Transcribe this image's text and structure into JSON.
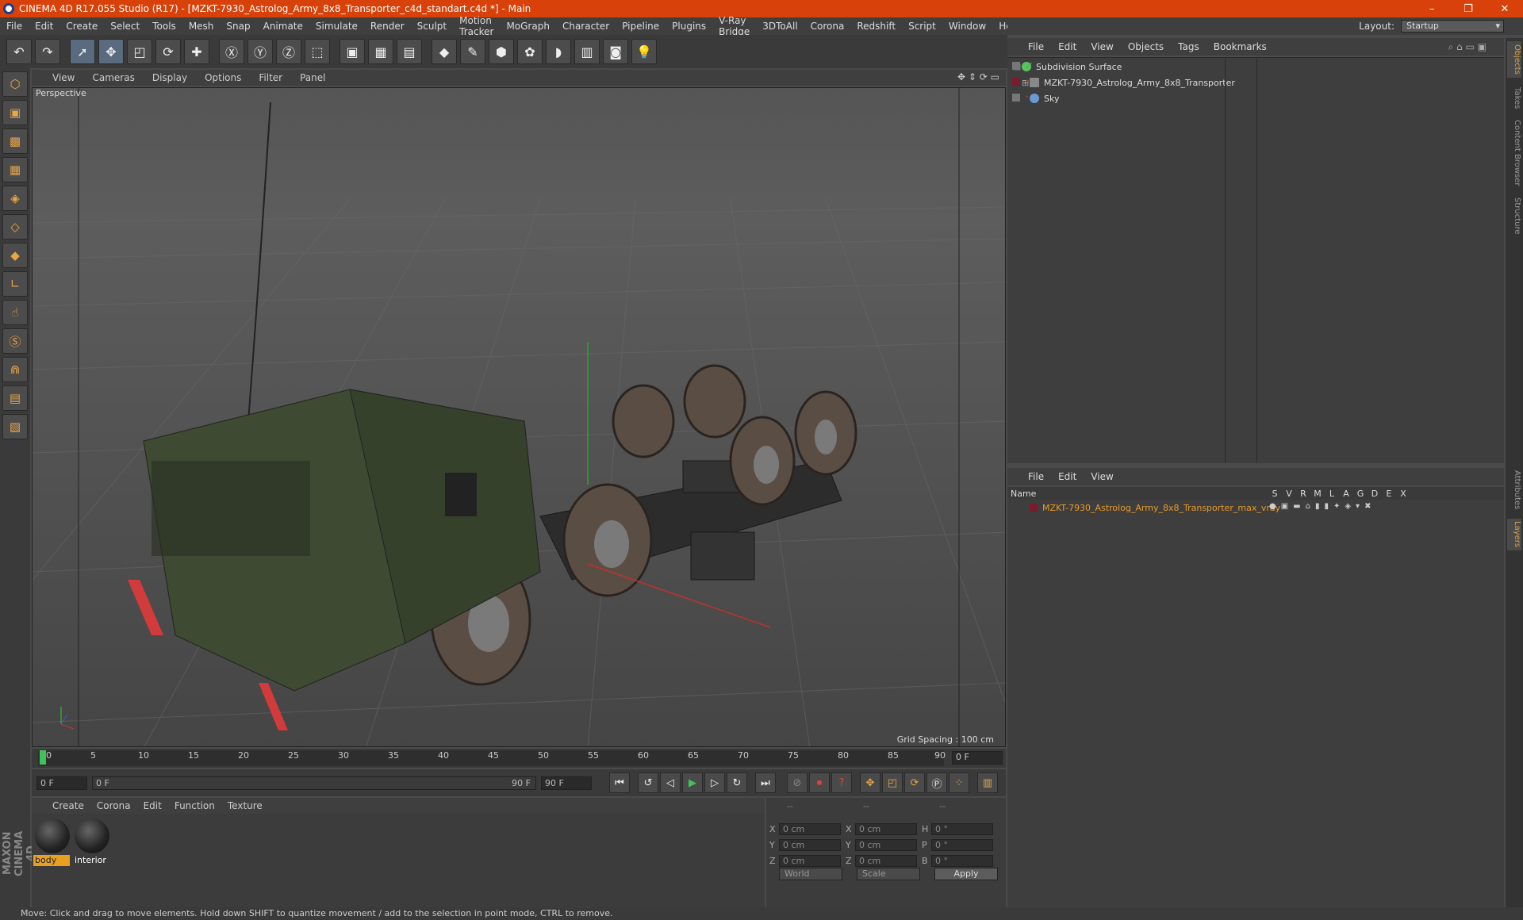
{
  "window": {
    "title": "CINEMA 4D R17.055 Studio (R17) - [MZKT-7930_Astrolog_Army_8x8_Transporter_c4d_standart.c4d *] - Main",
    "minimize": "–",
    "restore": "❐",
    "close": "✕"
  },
  "menubar": [
    "File",
    "Edit",
    "Create",
    "Select",
    "Tools",
    "Mesh",
    "Snap",
    "Animate",
    "Simulate",
    "Render",
    "Sculpt",
    "Motion Tracker",
    "MoGraph",
    "Character",
    "Pipeline",
    "Plugins",
    "V-Ray Bridge",
    "3DToAll",
    "Corona",
    "Redshift",
    "Script",
    "Window",
    "Help"
  ],
  "layout": {
    "label": "Layout:",
    "value": "Startup"
  },
  "viewport": {
    "menu": [
      "View",
      "Cameras",
      "Display",
      "Options",
      "Filter",
      "Panel"
    ],
    "camera_label": "Perspective",
    "grid_spacing": "Grid Spacing : 100 cm"
  },
  "timeline": {
    "ticks": [
      "0",
      "5",
      "10",
      "15",
      "20",
      "25",
      "30",
      "35",
      "40",
      "45",
      "50",
      "55",
      "60",
      "65",
      "70",
      "75",
      "80",
      "85",
      "90"
    ],
    "current_frame": "0 F",
    "start": "0 F",
    "range_start": "0 F",
    "range_end": "90 F",
    "end": "90 F"
  },
  "materials": {
    "menu": [
      "Create",
      "Corona",
      "Edit",
      "Function",
      "Texture"
    ],
    "items": [
      {
        "label": "body"
      },
      {
        "label": "interior"
      }
    ]
  },
  "coords": {
    "headers": [
      "--",
      "--",
      "--"
    ],
    "rows": [
      {
        "l1": "X",
        "v1": "0 cm",
        "l2": "X",
        "v2": "0 cm",
        "l3": "H",
        "v3": "0 °"
      },
      {
        "l1": "Y",
        "v1": "0 cm",
        "l2": "Y",
        "v2": "0 cm",
        "l3": "P",
        "v3": "0 °"
      },
      {
        "l1": "Z",
        "v1": "0 cm",
        "l2": "Z",
        "v2": "0 cm",
        "l3": "B",
        "v3": "0 °"
      }
    ],
    "mode": "World",
    "transform": "Scale",
    "apply": "Apply"
  },
  "objects": {
    "menu": [
      "File",
      "Edit",
      "View",
      "Objects",
      "Tags",
      "Bookmarks"
    ],
    "items": [
      {
        "name": "Subdivision Surface",
        "color": "#5cc25c"
      },
      {
        "name": "MZKT-7930_Astrolog_Army_8x8_Transporter",
        "color": "#888888"
      },
      {
        "name": "Sky",
        "color": "#6a9ad6"
      }
    ]
  },
  "layers": {
    "menu": [
      "File",
      "Edit",
      "View"
    ],
    "header_name": "Name",
    "columns": [
      "S",
      "V",
      "R",
      "M",
      "L",
      "A",
      "G",
      "D",
      "E",
      "X"
    ],
    "items": [
      {
        "name": "MZKT-7930_Astrolog_Army_8x8_Transporter_max_vray"
      }
    ]
  },
  "right_tabs": [
    "Objects",
    "Takes",
    "Content Browser",
    "Structure",
    "Attributes",
    "Layers"
  ],
  "status": "Move: Click and drag to move elements. Hold down SHIFT to quantize movement / add to the selection in point mode, CTRL to remove.",
  "brand": "MAXON CINEMA 4D"
}
